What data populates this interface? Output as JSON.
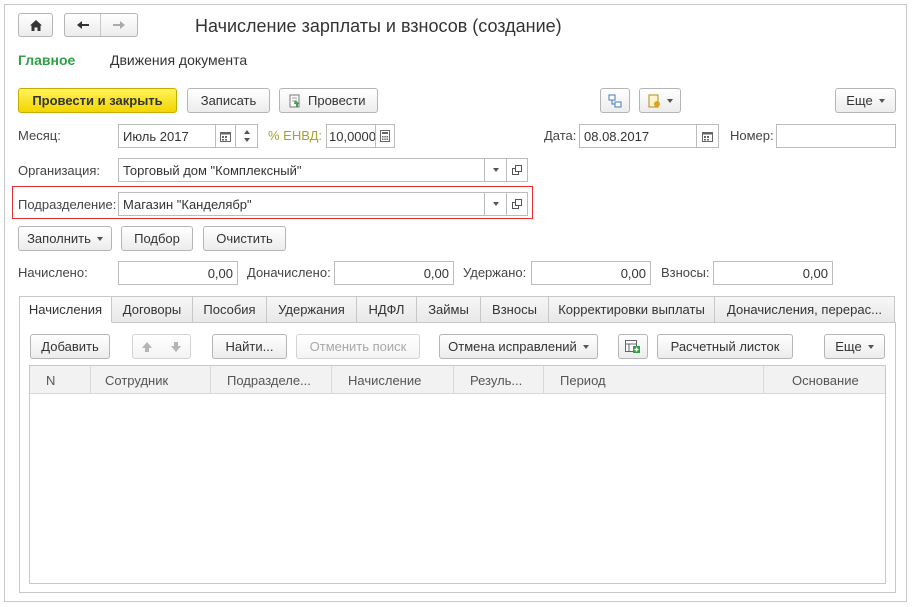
{
  "window": {
    "title": "Начисление зарплаты и взносов (создание)"
  },
  "nav": {
    "home_icon": "home-icon",
    "back_icon": "arrow-left-icon",
    "forward_icon": "arrow-right-icon",
    "main_link": "Главное",
    "movements_link": "Движения документа",
    "accent_color": "#2fa046"
  },
  "toolbar": {
    "post_close": "Провести и закрыть",
    "save": "Записать",
    "post": "Провести",
    "more": "Еще"
  },
  "header": {
    "month_label": "Месяц:",
    "month_value": "Июль 2017",
    "envd_label": "% ЕНВД:",
    "envd_value": "10,0000",
    "date_label": "Дата:",
    "date_value": "08.08.2017",
    "number_label": "Номер:",
    "number_value": "",
    "org_label": "Организация:",
    "org_value": "Торговый дом \"Комплексный\"",
    "dept_label": "Подразделение:",
    "dept_value": "Магазин \"Канделябр\"",
    "dept_highlight": "#e03030"
  },
  "actions": {
    "fill": "Заполнить",
    "select": "Подбор",
    "clear": "Очистить"
  },
  "totals": {
    "accrued_label": "Начислено:",
    "accrued_value": "0,00",
    "additional_label": "Доначислено:",
    "additional_value": "0,00",
    "withheld_label": "Удержано:",
    "withheld_value": "0,00",
    "contributions_label": "Взносы:",
    "contributions_value": "0,00"
  },
  "tabs": [
    {
      "label": "Начисления",
      "active": true
    },
    {
      "label": "Договоры"
    },
    {
      "label": "Пособия"
    },
    {
      "label": "Удержания"
    },
    {
      "label": "НДФЛ"
    },
    {
      "label": "Займы"
    },
    {
      "label": "Взносы"
    },
    {
      "label": "Корректировки выплаты"
    },
    {
      "label": "Доначисления, перерас..."
    }
  ],
  "table_toolbar": {
    "add": "Добавить",
    "find": "Найти...",
    "cancel_search": "Отменить поиск",
    "cancel_corrections": "Отмена исправлений",
    "payslip": "Расчетный листок",
    "more": "Еще"
  },
  "table": {
    "columns": [
      "N",
      "Сотрудник",
      "Подразделе...",
      "Начисление",
      "Резуль...",
      "Период",
      "Основание"
    ],
    "rows": []
  }
}
